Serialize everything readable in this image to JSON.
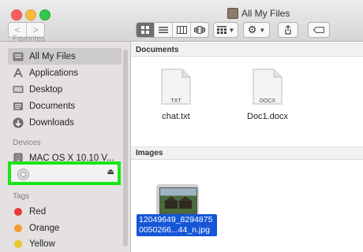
{
  "window": {
    "title": "All My Files"
  },
  "toolbar": {
    "back_label": "<",
    "forward_label": ">"
  },
  "sidebar": {
    "favorites_header": "Favorites",
    "favorites": [
      {
        "label": "All My Files",
        "icon": "all-files-icon"
      },
      {
        "label": "Applications",
        "icon": "applications-icon"
      },
      {
        "label": "Desktop",
        "icon": "desktop-icon"
      },
      {
        "label": "Documents",
        "icon": "documents-icon"
      },
      {
        "label": "Downloads",
        "icon": "downloads-icon"
      }
    ],
    "devices_header": "Devices",
    "devices": [
      {
        "label": "MAC OS X 10.10 V...",
        "icon": "hard-drive-icon"
      },
      {
        "label": "",
        "icon": "disc-icon",
        "eject": "⏏"
      }
    ],
    "tags_header": "Tags",
    "tags": [
      {
        "label": "Red",
        "color": "#e8383b"
      },
      {
        "label": "Orange",
        "color": "#f59b2c"
      },
      {
        "label": "Yellow",
        "color": "#e8c72c"
      }
    ]
  },
  "main": {
    "documents_header": "Documents",
    "documents": [
      {
        "name": "chat.txt",
        "badge": "TXT"
      },
      {
        "name": "Doc1.docx",
        "badge": "DOCX"
      }
    ],
    "images_header": "Images",
    "images": [
      {
        "name_line1": "12049649_8294875",
        "name_line2": "0050266...44_n.jpg"
      }
    ]
  },
  "colors": {
    "highlight_border": "#19e619",
    "selection": "#1557d6"
  }
}
